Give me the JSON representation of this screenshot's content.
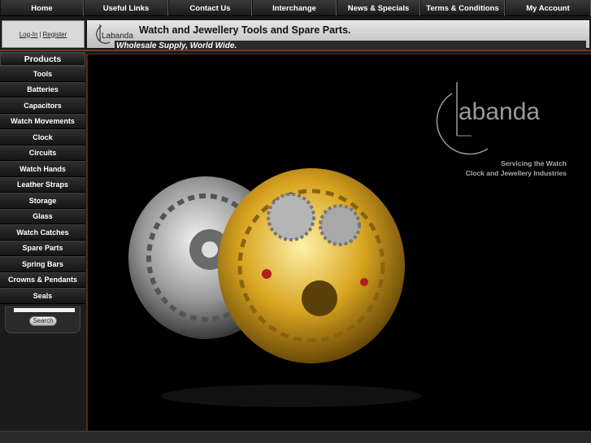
{
  "nav": {
    "items": [
      {
        "label": "Home"
      },
      {
        "label": "Useful Links"
      },
      {
        "label": "Contact Us"
      },
      {
        "label": "Interchange"
      },
      {
        "label": "News & Specials"
      },
      {
        "label": "Terms & Conditions"
      },
      {
        "label": "My Account"
      }
    ]
  },
  "header": {
    "login_label": "Log-In",
    "separator": "|",
    "register_label": "Register",
    "title": "Watch and Jewellery Tools and Spare Parts.",
    "subtitle": "Wholesale Supply, World Wide.",
    "logo_text": "Labanda"
  },
  "sidebar": {
    "heading": "Products",
    "items": [
      {
        "label": "Tools"
      },
      {
        "label": "Batteries"
      },
      {
        "label": "Capacitors"
      },
      {
        "label": "Watch Movements"
      },
      {
        "label": "Clock"
      },
      {
        "label": "Circuits"
      },
      {
        "label": "Watch Hands"
      },
      {
        "label": "Leather Straps"
      },
      {
        "label": "Storage"
      },
      {
        "label": "Glass"
      },
      {
        "label": "Watch Catches"
      },
      {
        "label": "Spare Parts"
      },
      {
        "label": "Spring Bars"
      },
      {
        "label": "Crowns & Pendants"
      },
      {
        "label": "Seals"
      }
    ],
    "search_value": "",
    "search_button": "Search"
  },
  "hero": {
    "logo_text": "abanda",
    "tagline_line1": "Servicing the Watch",
    "tagline_line2": "Clock and Jewellery Industries"
  },
  "colors": {
    "accent_line": "#7a3a1a",
    "gold": "#d9a520",
    "silver": "#c8c8c8"
  }
}
